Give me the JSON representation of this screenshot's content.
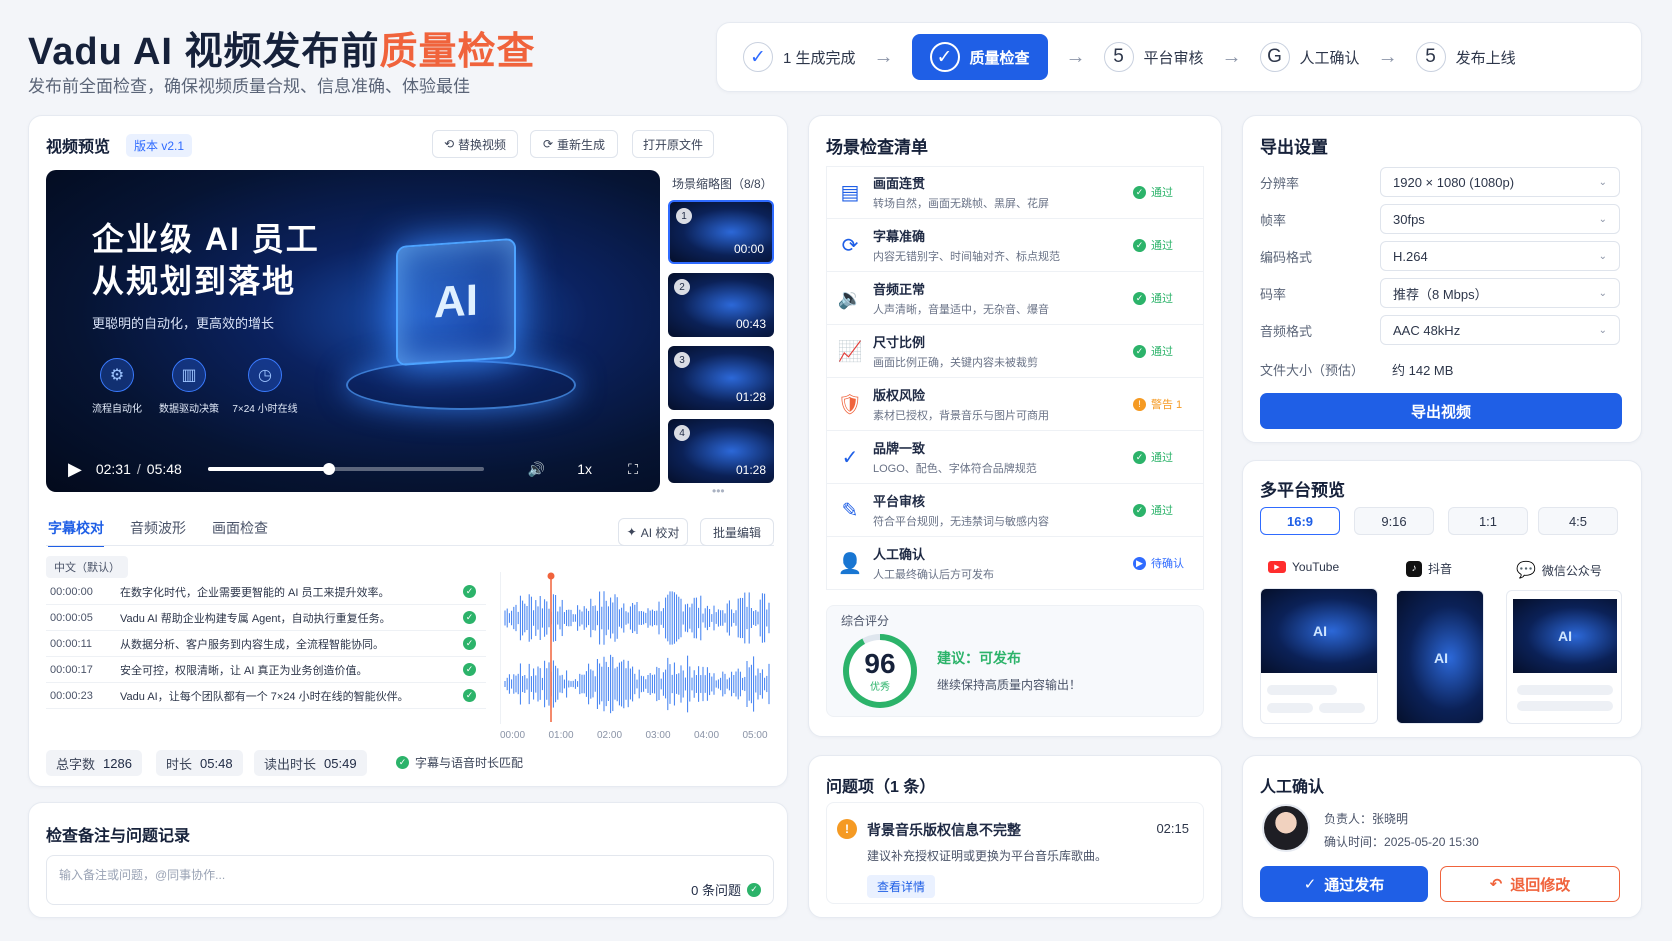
{
  "header": {
    "title_main": "Vadu AI 视频发布前",
    "title_accent": "质量检查",
    "subtitle": "发布前全面检查，确保视频质量合规、信息准确、体验最佳"
  },
  "stepper": [
    {
      "num": "✓",
      "label": "1 生成完成",
      "state": "done"
    },
    {
      "num": "✓",
      "label": "质量检查",
      "state": "active"
    },
    {
      "num": "5",
      "label": "平台审核",
      "state": "todo"
    },
    {
      "num": "G",
      "label": "人工确认",
      "state": "todo"
    },
    {
      "num": "5",
      "label": "发布上线",
      "state": "todo"
    }
  ],
  "preview": {
    "title": "视频预览",
    "version": "版本 v2.1",
    "btn_replace": "替换视频",
    "btn_regen": "重新生成",
    "btn_open": "打开原文件",
    "video_title_1": "企业级 AI 员工",
    "video_title_2": "从规划到落地",
    "video_sub": "更聪明的自动化，更高效的增长",
    "features": [
      "流程自动化",
      "数据驱动决策",
      "7×24 小时在线"
    ],
    "cube_text": "AI",
    "current_time": "02:31",
    "sep": "/",
    "total_time": "05:48",
    "speed": "1x",
    "progress": 0.44,
    "thumbs_title": "场景缩略图（8/8）",
    "thumbs": [
      {
        "n": "1",
        "t": "00:00"
      },
      {
        "n": "2",
        "t": "00:43"
      },
      {
        "n": "3",
        "t": "01:28"
      },
      {
        "n": "4",
        "t": "01:28"
      }
    ]
  },
  "tabs": {
    "items": [
      "字幕校对",
      "音频波形",
      "画面检查"
    ],
    "ai_check": "AI 校对",
    "batch_edit": "批量编辑",
    "lang": "中文（默认）"
  },
  "subtitles": [
    {
      "t": "00:00:00",
      "text": "在数字化时代，企业需要更智能的 AI 员工来提升效率。"
    },
    {
      "t": "00:00:05",
      "text": "Vadu AI 帮助企业构建专属 Agent，自动执行重复任务。"
    },
    {
      "t": "00:00:11",
      "text": "从数据分析、客户服务到内容生成，全流程智能协同。"
    },
    {
      "t": "00:00:17",
      "text": "安全可控，权限清晰，让 AI 真正为业务创造价值。"
    },
    {
      "t": "00:00:23",
      "text": "Vadu AI，让每个团队都有一个 7×24 小时在线的智能伙伴。"
    }
  ],
  "wave_axis": [
    "00:00",
    "01:00",
    "02:00",
    "03:00",
    "04:00",
    "05:00"
  ],
  "stats": {
    "words_label": "总字数",
    "words": "1286",
    "dur_label": "时长",
    "dur": "05:48",
    "read_label": "读出时长",
    "read": "05:49",
    "match": "字幕与语音时长匹配"
  },
  "notes": {
    "title": "检查备注与问题记录",
    "placeholder": "输入备注或问题，@同事协作...",
    "count": "0 条问题"
  },
  "checklist": {
    "title": "场景检查清单",
    "items": [
      {
        "icon": "scene-icon",
        "glyph": "▤",
        "name": "画面连贯",
        "desc": "转场自然，画面无跳帧、黑屏、花屏",
        "status": "通过",
        "type": "pass"
      },
      {
        "icon": "subtitle-icon",
        "glyph": "⟳",
        "name": "字幕准确",
        "desc": "内容无错别字、时间轴对齐、标点规范",
        "status": "通过",
        "type": "pass"
      },
      {
        "icon": "audio-icon",
        "glyph": "🔉",
        "name": "音频正常",
        "desc": "人声清晰，音量适中，无杂音、爆音",
        "status": "通过",
        "type": "pass"
      },
      {
        "icon": "ratio-icon",
        "glyph": "📈",
        "name": "尺寸比例",
        "desc": "画面比例正确，关键内容未被裁剪",
        "status": "通过",
        "type": "pass"
      },
      {
        "icon": "copyright-icon",
        "glyph": "🛡",
        "name": "版权风险",
        "desc": "素材已授权，背景音乐与图片可商用",
        "status": "警告 1",
        "type": "warn"
      },
      {
        "icon": "brand-icon",
        "glyph": "✓",
        "name": "品牌一致",
        "desc": "LOGO、配色、字体符合品牌规范",
        "status": "通过",
        "type": "pass"
      },
      {
        "icon": "platform-icon",
        "glyph": "✎",
        "name": "平台审核",
        "desc": "符合平台规则，无违禁词与敏感内容",
        "status": "通过",
        "type": "pass"
      },
      {
        "icon": "person-icon",
        "glyph": "👤",
        "name": "人工确认",
        "desc": "人工最终确认后方可发布",
        "status": "待确认",
        "type": "pending"
      }
    ],
    "score_label": "综合评分",
    "score": "96",
    "score_level": "优秀",
    "advice": "建议：可发布",
    "advice_sub": "继续保持高质量内容输出！"
  },
  "issues": {
    "title": "问题项（1 条）",
    "item_title": "背景音乐版权信息不完整",
    "item_time": "02:15",
    "item_desc": "建议补充授权证明或更换为平台音乐库歌曲。",
    "detail_btn": "查看详情"
  },
  "export": {
    "title": "导出设置",
    "rows": [
      {
        "label": "分辨率",
        "value": "1920 × 1080 (1080p)"
      },
      {
        "label": "帧率",
        "value": "30fps"
      },
      {
        "label": "编码格式",
        "value": "H.264"
      },
      {
        "label": "码率",
        "value": "推荐（8 Mbps）"
      },
      {
        "label": "音频格式",
        "value": "AAC 48kHz"
      }
    ],
    "size_label": "文件大小（预估）",
    "size_value": "约 142 MB",
    "btn": "导出视频"
  },
  "multi": {
    "title": "多平台预览",
    "ratios": [
      "16:9",
      "9:16",
      "1:1",
      "4:5"
    ],
    "platforms": [
      "YouTube",
      "抖音",
      "微信公众号"
    ]
  },
  "confirm": {
    "title": "人工确认",
    "owner_label": "负责人：",
    "owner": "张晓明",
    "time_label": "确认时间：",
    "time": "2025-05-20 15:30",
    "approve": "通过发布",
    "reject": "退回修改"
  }
}
